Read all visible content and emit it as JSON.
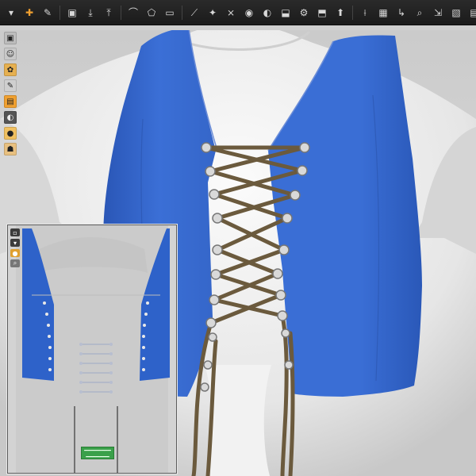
{
  "app": {
    "accent_color": "#3a6fd8",
    "garment_color": "#3a6fd8",
    "lace_color": "#6b5a3d",
    "avatar_color": "#e9e9e9"
  },
  "toolbar": {
    "icons": [
      "chevron-down-icon",
      "add-point-icon",
      "edit-curve-icon",
      "separator",
      "save-icon",
      "import-icon",
      "export-icon",
      "separator",
      "curve-tool-icon",
      "polygon-tool-icon",
      "rectangle-tool-icon",
      "separator",
      "fold-icon",
      "tack-icon",
      "sew-icon",
      "trace-icon",
      "seam-line-icon",
      "arrangement-icon",
      "simulate-icon",
      "layer-icon",
      "pin-icon",
      "separator",
      "measure-icon",
      "grid-icon"
    ]
  },
  "left_toolbar": {
    "icons": [
      "select-icon",
      "avatar-icon",
      "material-icon",
      "brush-icon",
      "texture-icon",
      "shading-icon",
      "color-icon",
      "pose-icon"
    ]
  },
  "pattern_window": {
    "tool_icons": [
      "select-pattern-icon",
      "transform-pattern-icon",
      "edit-point-icon",
      "zoom-icon"
    ],
    "status_lines": [
      "━━━━━━━━",
      "━━━━━━━",
      "━━━━━━━━"
    ]
  }
}
